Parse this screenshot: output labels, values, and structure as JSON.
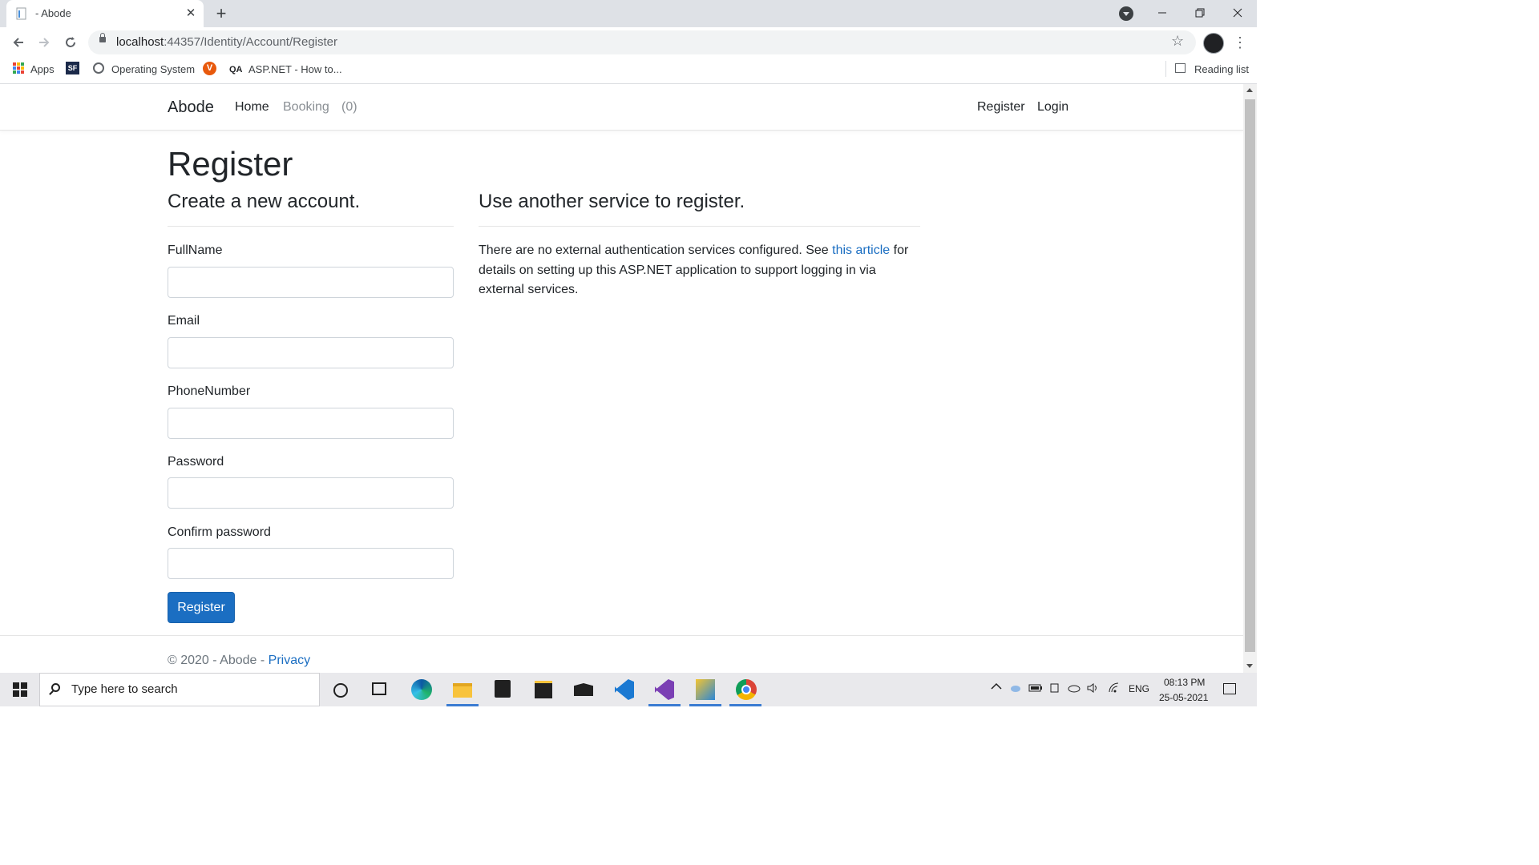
{
  "browser": {
    "tab_title": "- Abode",
    "tab_close": "✕",
    "new_tab": "+",
    "url_host": "localhost",
    "url_path": ":44357/Identity/Account/Register",
    "bookmarks": {
      "apps": "Apps",
      "sf": "SF",
      "operating_system": "Operating System",
      "v_badge": "V",
      "qa_badge": "QA",
      "aspnet": "ASP.NET - How to...",
      "reading_list": "Reading list"
    }
  },
  "navbar": {
    "brand": "Abode",
    "home": "Home",
    "booking": "Booking",
    "booking_count": "(0)",
    "register": "Register",
    "login": "Login"
  },
  "main": {
    "title": "Register",
    "form_heading": "Create a new account.",
    "external_heading": "Use another service to register.",
    "external_text_before": "There are no external authentication services configured. See ",
    "external_link": "this article",
    "external_text_after": " for details on setting up this ASP.NET application to support logging in via external services.",
    "fields": {
      "fullname_label": "FullName",
      "email_label": "Email",
      "phone_label": "PhoneNumber",
      "password_label": "Password",
      "confirm_label": "Confirm password",
      "fullname_value": "",
      "email_value": "",
      "phone_value": "",
      "password_value": "",
      "confirm_value": ""
    },
    "register_button": "Register"
  },
  "footer": {
    "text": "© 2020 - Abode - ",
    "privacy": "Privacy"
  },
  "taskbar": {
    "search_placeholder": "Type here to search",
    "language": "ENG",
    "time": "08:13 PM",
    "date": "25-05-2021"
  }
}
